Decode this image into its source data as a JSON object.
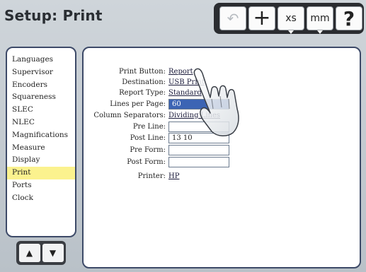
{
  "header": {
    "title": "Setup: Print"
  },
  "toolbar": {
    "undo_icon": "undo-arrow-icon",
    "add_icon": "plus-icon",
    "xs_label": "xs",
    "mm_label": "mm",
    "help_label": "?"
  },
  "sidebar": {
    "items": [
      {
        "label": "Languages",
        "selected": false
      },
      {
        "label": "Supervisor",
        "selected": false
      },
      {
        "label": "Encoders",
        "selected": false
      },
      {
        "label": "Squareness",
        "selected": false
      },
      {
        "label": "SLEC",
        "selected": false
      },
      {
        "label": "NLEC",
        "selected": false
      },
      {
        "label": "Magnifications",
        "selected": false
      },
      {
        "label": "Measure",
        "selected": false
      },
      {
        "label": "Display",
        "selected": false
      },
      {
        "label": "Print",
        "selected": true
      },
      {
        "label": "Ports",
        "selected": false
      },
      {
        "label": "Clock",
        "selected": false
      }
    ],
    "up_icon": "arrow-up-icon",
    "down_icon": "arrow-down-icon",
    "up_glyph": "▲",
    "down_glyph": "▼"
  },
  "print_settings": {
    "print_button": {
      "label": "Print Button:",
      "value": "Report"
    },
    "destination": {
      "label": "Destination:",
      "value": "USB Print"
    },
    "report_type": {
      "label": "Report Type:",
      "value": "Standard"
    },
    "lines_per_page": {
      "label": "Lines per Page:",
      "value": "60"
    },
    "column_separators": {
      "label": "Column Separators:",
      "value": "Dividing Lines"
    },
    "pre_line": {
      "label": "Pre Line:",
      "value": ""
    },
    "post_line": {
      "label": "Post Line:",
      "value": "13 10"
    },
    "pre_form": {
      "label": "Pre Form:",
      "value": ""
    },
    "post_form": {
      "label": "Post Form:",
      "value": ""
    },
    "printer": {
      "label": "Printer:",
      "value": "HP"
    }
  },
  "colors": {
    "selected_item": "#fbf28e",
    "selected_field": "#3c64b4",
    "panel_border": "#3d4a68",
    "toolbar_bg": "#2a2c30"
  }
}
